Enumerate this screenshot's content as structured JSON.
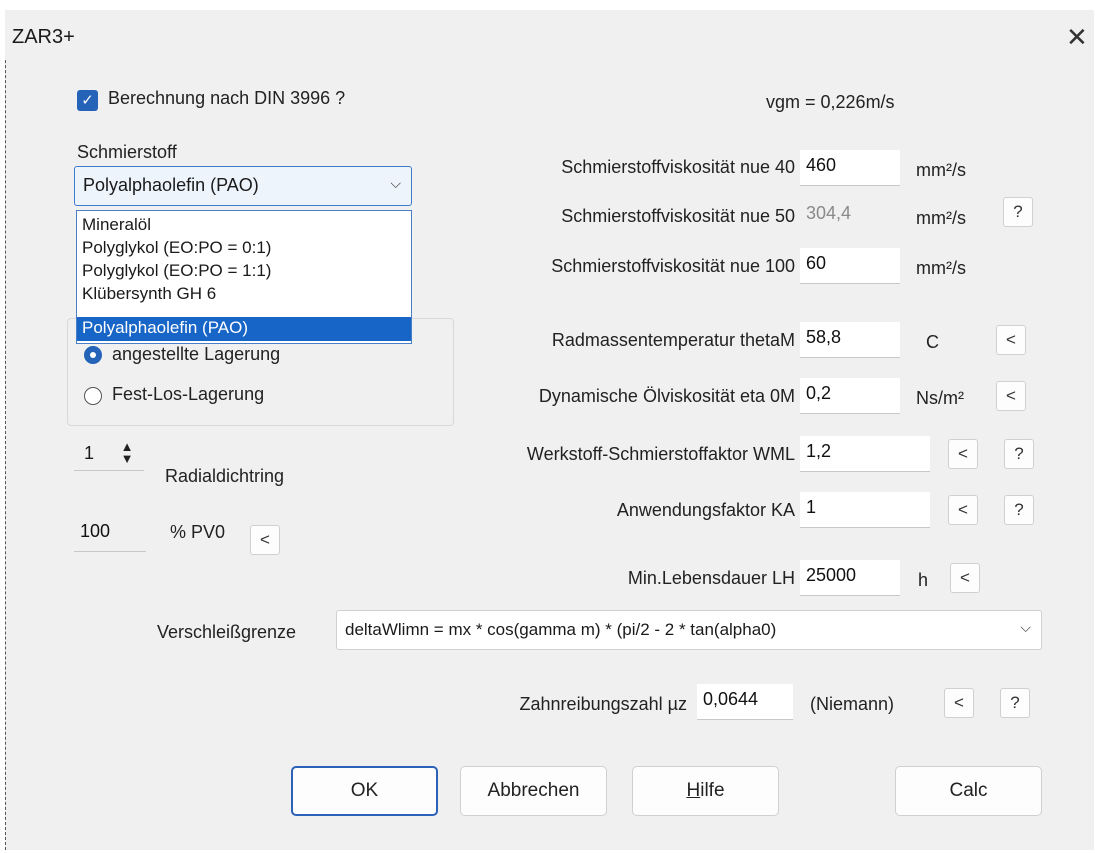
{
  "window": {
    "title": "ZAR3+",
    "close_glyph": "✕"
  },
  "din_check": {
    "label": "Berechnung nach DIN 3996 ?",
    "checked": true
  },
  "vgm": "vgm = 0,226m/s",
  "lubricant": {
    "label": "Schmierstoff",
    "selected": "Polyalphaolefin (PAO)",
    "options": [
      "Mineralöl",
      "Polyglykol (EO:PO = 0:1)",
      "Polyglykol (EO:PO = 1:1)",
      "Klübersynth GH 6",
      "Polyalphaolefin (PAO)"
    ]
  },
  "bearing": {
    "option1": "angestellte Lagerung",
    "option2": "Fest-Los-Lagerung",
    "selected": "angestellte Lagerung"
  },
  "seal": {
    "count": "1",
    "label": "Radialdichtring"
  },
  "pv0": {
    "value": "100",
    "label": "% PV0"
  },
  "fields": {
    "nue40": {
      "label": "Schmierstoffviskosität nue 40",
      "value": "460",
      "unit": "mm²/s"
    },
    "nue50": {
      "label": "Schmierstoffviskosität nue 50",
      "value": "304,4",
      "unit": "mm²/s"
    },
    "nue100": {
      "label": "Schmierstoffviskosität nue 100",
      "value": "60",
      "unit": "mm²/s"
    },
    "thetaM": {
      "label": "Radmassentemperatur thetaM",
      "value": "58,8",
      "unit": "C"
    },
    "eta0M": {
      "label": "Dynamische Ölviskosität eta 0M",
      "value": "0,2",
      "unit": "Ns/m²"
    },
    "wml": {
      "label": "Werkstoff-Schmierstoffaktor WML",
      "value": "1,2"
    },
    "ka": {
      "label": "Anwendungsfaktor KA",
      "value": "1"
    },
    "lh": {
      "label": "Min.Lebensdauer LH",
      "value": "25000",
      "unit": "h"
    },
    "mu": {
      "label": "Zahnreibungszahl µz",
      "value": "0,0644",
      "note": "(Niemann)"
    }
  },
  "wear": {
    "label": "Verschleißgrenze",
    "value": "deltaWlimn = mx * cos(gamma m) * (pi/2 - 2 * tan(alpha0)"
  },
  "glyphs": {
    "back": "<",
    "help": "?",
    "check": "✓",
    "chevron": "⌵",
    "spin_up": "▲",
    "spin_down": "▼"
  },
  "buttons": {
    "ok": "OK",
    "cancel": "Abbrechen",
    "help_prefix": "",
    "help_mnemonic": "H",
    "help_rest": "ilfe",
    "calc": "Calc"
  },
  "colors": {
    "accent": "#2563b8",
    "selection": "#1765c7",
    "dialog_bg": "#f0f0f0"
  }
}
